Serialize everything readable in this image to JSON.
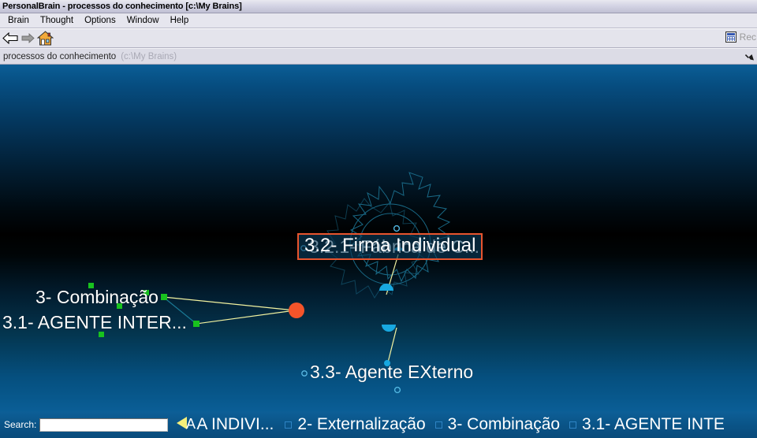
{
  "window": {
    "title": "PersonalBrain - processos do conhecimento [c:\\My Brains]"
  },
  "menubar": {
    "items": [
      {
        "label": "Brain",
        "name": "menu-brain"
      },
      {
        "label": "Thought",
        "name": "menu-thought"
      },
      {
        "label": "Options",
        "name": "menu-options"
      },
      {
        "label": "Window",
        "name": "menu-window"
      },
      {
        "label": "Help",
        "name": "menu-help"
      }
    ]
  },
  "toolbar": {
    "back_icon": "back-arrow-icon",
    "forward_icon": "forward-arrow-icon",
    "home_icon": "home-icon",
    "rec_label": "Rec",
    "rec_icon": "grid-list-icon"
  },
  "breadcrumb": {
    "brain_name": "processos do conhecimento",
    "brain_path": "(c:\\My Brains)"
  },
  "canvas": {
    "selected_thought": {
      "label": "3.2- Firma Individual",
      "border_color": "#e8552e",
      "fill_color": "rgba(10,60,90,0.62)"
    },
    "active_dot_color": "#f4542a",
    "child_thoughts": [
      {
        "label": "3.2.1- Fábrica de C...",
        "marker": "hollow-circle",
        "marker_color": "#3fa9d8"
      },
      {
        "label": "3.3-  Agente EXterno",
        "marker": "hollow-circle",
        "marker_color": "#3fa9d8"
      }
    ],
    "parent_thoughts": [
      {
        "label": "3- Combinação",
        "marker": "filled-square",
        "marker_color": "#18c21e"
      },
      {
        "label": "3.1- AGENTE INTER...",
        "marker": "filled-square",
        "marker_color": "#18c21e"
      }
    ],
    "link_color": "#f2f2a0",
    "sibling_link_color": "#1a7a96",
    "gate_color": "#1b6e8c"
  },
  "statusbar": {
    "search_label": "Search:",
    "search_value": "",
    "search_placeholder": "",
    "back_arrow_icon": "yellow-back-arrow-icon",
    "pins": [
      {
        "label": "A INDIVI...",
        "has_box": false
      },
      {
        "label": "2- Externalização",
        "has_box": true
      },
      {
        "label": "3- Combinação",
        "has_box": true
      },
      {
        "label": "3.1- AGENTE INTE",
        "has_box": true
      }
    ]
  }
}
